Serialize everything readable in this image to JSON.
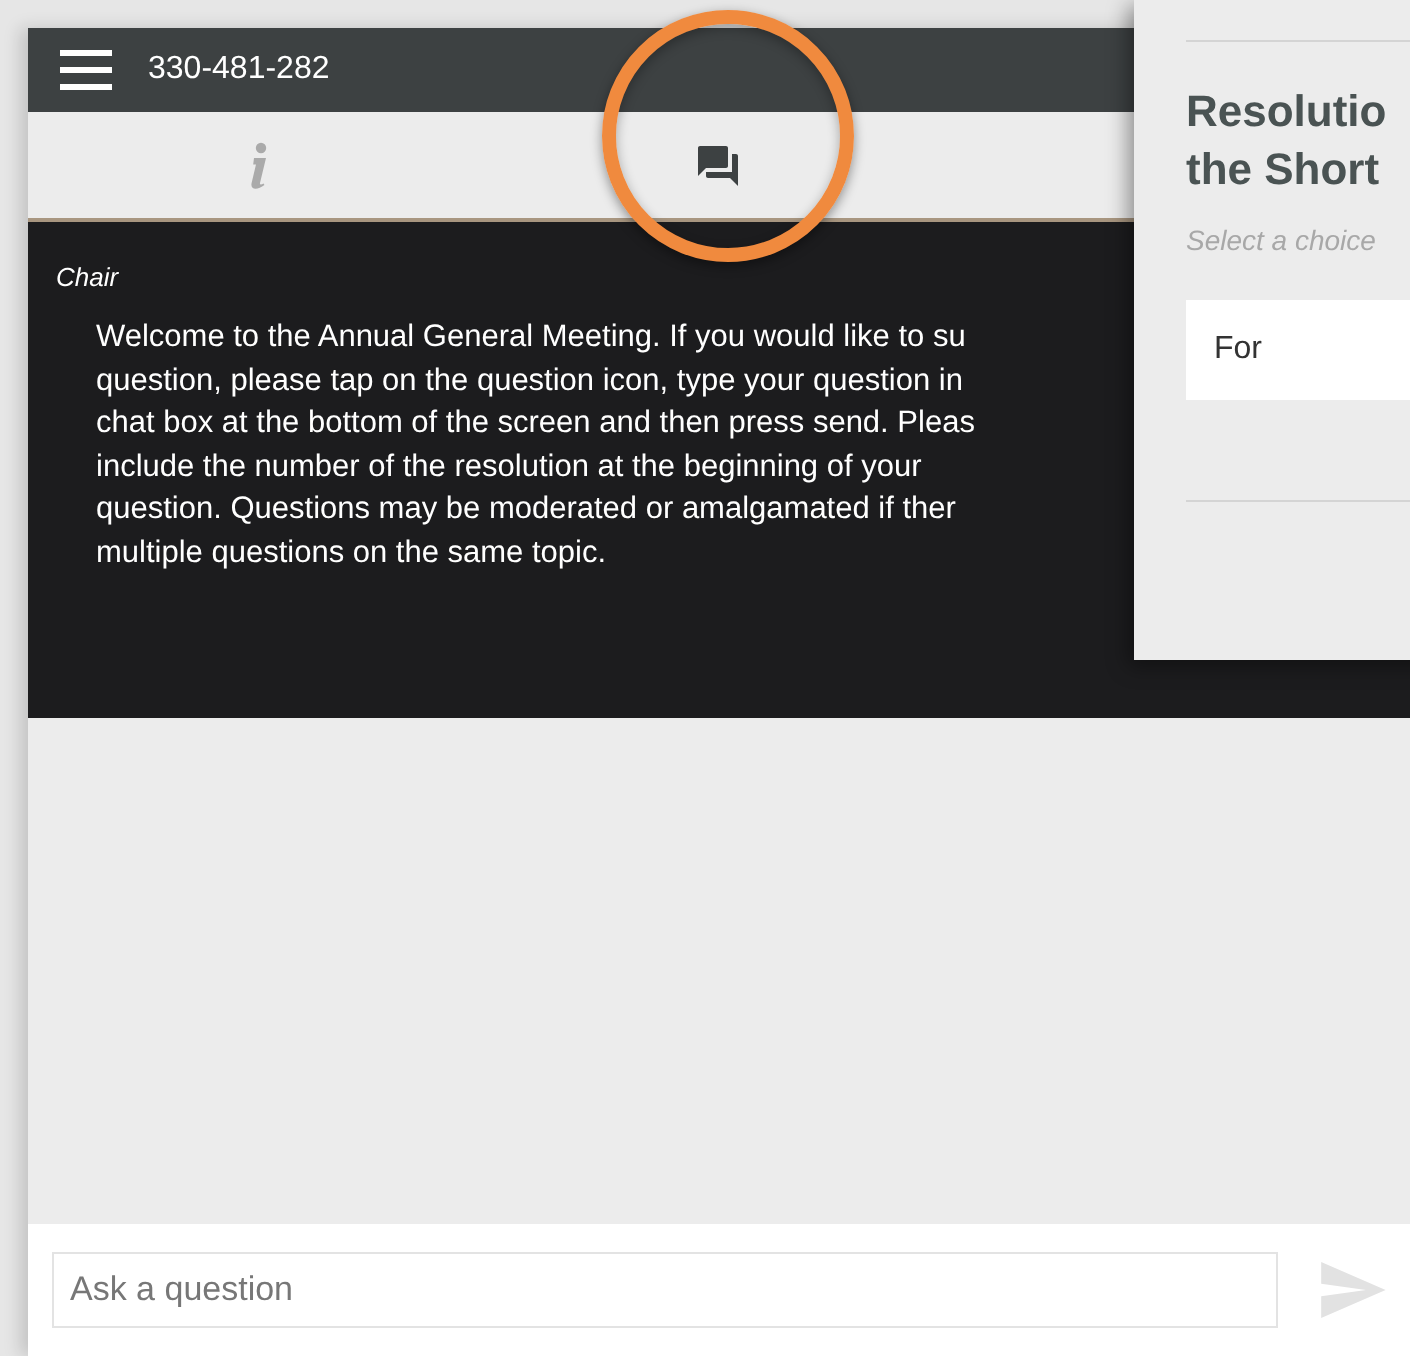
{
  "header": {
    "meeting_id": "330-481-282"
  },
  "tabs": [
    {
      "kind": "info",
      "selected": false
    },
    {
      "kind": "chat",
      "selected": true
    }
  ],
  "message": {
    "sender": "Chair",
    "lines": [
      "Welcome to the Annual General Meeting. If you would like to su",
      "question, please tap on the question icon, type your question in",
      "chat box at the bottom of the screen and then press send. Pleas",
      "include the number of the resolution at the beginning of your",
      "question. Questions may be moderated or amalgamated if ther",
      "multiple questions on the same topic."
    ]
  },
  "question_input": {
    "placeholder": "Ask a question"
  },
  "send_button": {
    "disabled": true
  },
  "resolution_panel": {
    "title_lines": [
      "Resolutio",
      "the Short"
    ],
    "placeholder": "Select a choice",
    "options": [
      "For"
    ]
  }
}
